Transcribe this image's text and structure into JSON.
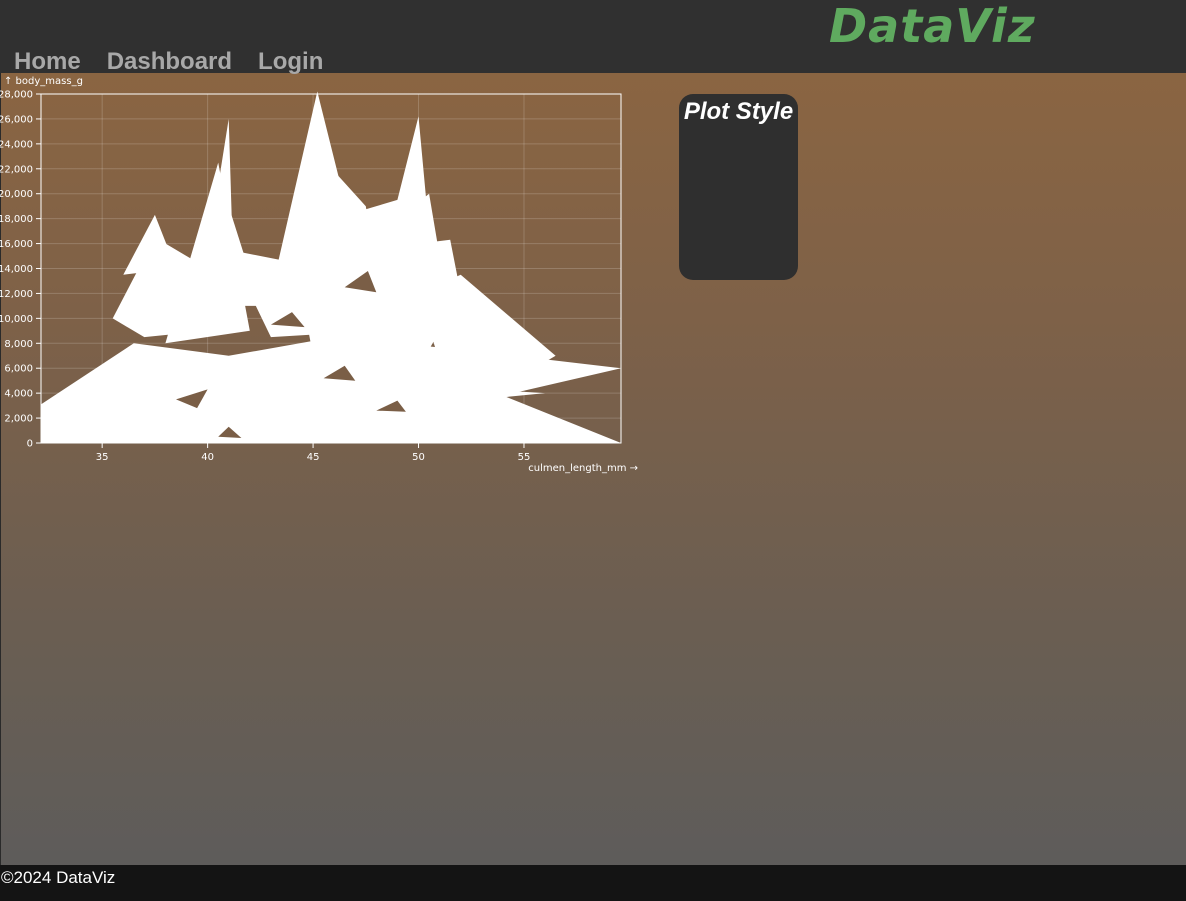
{
  "header": {
    "brand": "DataViz",
    "nav": [
      {
        "label": "Home"
      },
      {
        "label": "Dashboard"
      },
      {
        "label": "Login"
      }
    ]
  },
  "plot_style_panel": {
    "title": "Plot Style"
  },
  "footer": {
    "text": "©2024 DataViz"
  },
  "colors": {
    "header_bg": "#303030",
    "brand": "#5faa5f",
    "nav_text": "#a8a8a8",
    "panel_bg": "#2f2f2f",
    "footer_bg": "#141414",
    "mark": "#ffffff"
  },
  "chart_data": {
    "type": "area",
    "xlabel": "culmen_length_mm →",
    "ylabel": "↑ body_mass_g",
    "xlim": [
      32.1,
      59.6
    ],
    "ylim": [
      0,
      28000
    ],
    "x_ticks": [
      35,
      40,
      45,
      50,
      55
    ],
    "x_tick_labels": [
      "35",
      "40",
      "45",
      "50",
      "55"
    ],
    "y_ticks": [
      0,
      2000,
      4000,
      6000,
      8000,
      10000,
      12000,
      14000,
      16000,
      18000,
      20000,
      22000,
      24000,
      26000,
      28000
    ],
    "y_tick_labels": [
      "0",
      "2,000",
      "4,000",
      "6,000",
      "8,000",
      "10,000",
      "12,000",
      "14,000",
      "16,000",
      "18,000",
      "20,000",
      "22,000",
      "24,000",
      "26,000",
      "28,000"
    ],
    "grid": true,
    "polygons": [
      [
        [
          32.1,
          3100
        ],
        [
          36.5,
          8000
        ],
        [
          41,
          7000
        ],
        [
          46,
          8500
        ],
        [
          52,
          7500
        ],
        [
          59.6,
          6000
        ],
        [
          54,
          3800
        ],
        [
          59.6,
          0
        ],
        [
          32.1,
          0
        ]
      ],
      [
        [
          33,
          3200
        ],
        [
          38,
          5200
        ],
        [
          43,
          4500
        ],
        [
          47,
          6500
        ],
        [
          51,
          4500
        ],
        [
          56,
          4000
        ],
        [
          53,
          3500
        ],
        [
          33,
          3000
        ]
      ],
      [
        [
          35.5,
          10000
        ],
        [
          37.5,
          16500
        ],
        [
          39.5,
          14500
        ],
        [
          41,
          12000
        ],
        [
          40,
          9000
        ],
        [
          37,
          8500
        ]
      ],
      [
        [
          36,
          13500
        ],
        [
          37.5,
          18300
        ],
        [
          38.5,
          14000
        ]
      ],
      [
        [
          38,
          8000
        ],
        [
          40.5,
          22500
        ],
        [
          42,
          9000
        ]
      ],
      [
        [
          39.5,
          10000
        ],
        [
          41,
          26000
        ],
        [
          41.3,
          9500
        ]
      ],
      [
        [
          40,
          11000
        ],
        [
          41,
          19000
        ],
        [
          42.5,
          11000
        ]
      ],
      [
        [
          41,
          15500
        ],
        [
          44,
          14500
        ],
        [
          45,
          15000
        ],
        [
          48,
          9000
        ],
        [
          43,
          8500
        ]
      ],
      [
        [
          43,
          12000
        ],
        [
          45.2,
          28200
        ],
        [
          47,
          16000
        ],
        [
          44.5,
          9000
        ]
      ],
      [
        [
          45.2,
          16500
        ],
        [
          45.2,
          23300
        ],
        [
          47.5,
          19000
        ],
        [
          48,
          14000
        ]
      ],
      [
        [
          46,
          18000
        ],
        [
          49,
          19500
        ],
        [
          50,
          26200
        ],
        [
          50.5,
          17000
        ],
        [
          48,
          12000
        ]
      ],
      [
        [
          46,
          14000
        ],
        [
          50.5,
          20000
        ],
        [
          51,
          15000
        ],
        [
          49,
          9000
        ]
      ],
      [
        [
          44,
          16000
        ],
        [
          47,
          17500
        ],
        [
          50,
          16000
        ],
        [
          51.5,
          16300
        ],
        [
          52,
          12000
        ],
        [
          50,
          6000
        ],
        [
          45,
          7000
        ]
      ],
      [
        [
          50,
          12000
        ],
        [
          52,
          13500
        ],
        [
          56.5,
          7000
        ],
        [
          54,
          4500
        ],
        [
          51,
          6500
        ]
      ],
      [
        [
          47,
          4000
        ],
        [
          50,
          5500
        ],
        [
          53,
          3000
        ],
        [
          49,
          2000
        ]
      ],
      [
        [
          42,
          2000
        ],
        [
          44,
          6000
        ],
        [
          46,
          4500
        ],
        [
          44,
          1000
        ]
      ],
      [
        [
          44.5,
          3000
        ],
        [
          46,
          7500
        ],
        [
          48,
          5000
        ],
        [
          47,
          1500
        ]
      ],
      [
        [
          37,
          3000
        ],
        [
          40,
          5500
        ],
        [
          43,
          5000
        ],
        [
          40,
          2000
        ]
      ],
      [
        [
          47,
          9500
        ],
        [
          50,
          11000
        ],
        [
          49,
          7000
        ]
      ]
    ]
  }
}
